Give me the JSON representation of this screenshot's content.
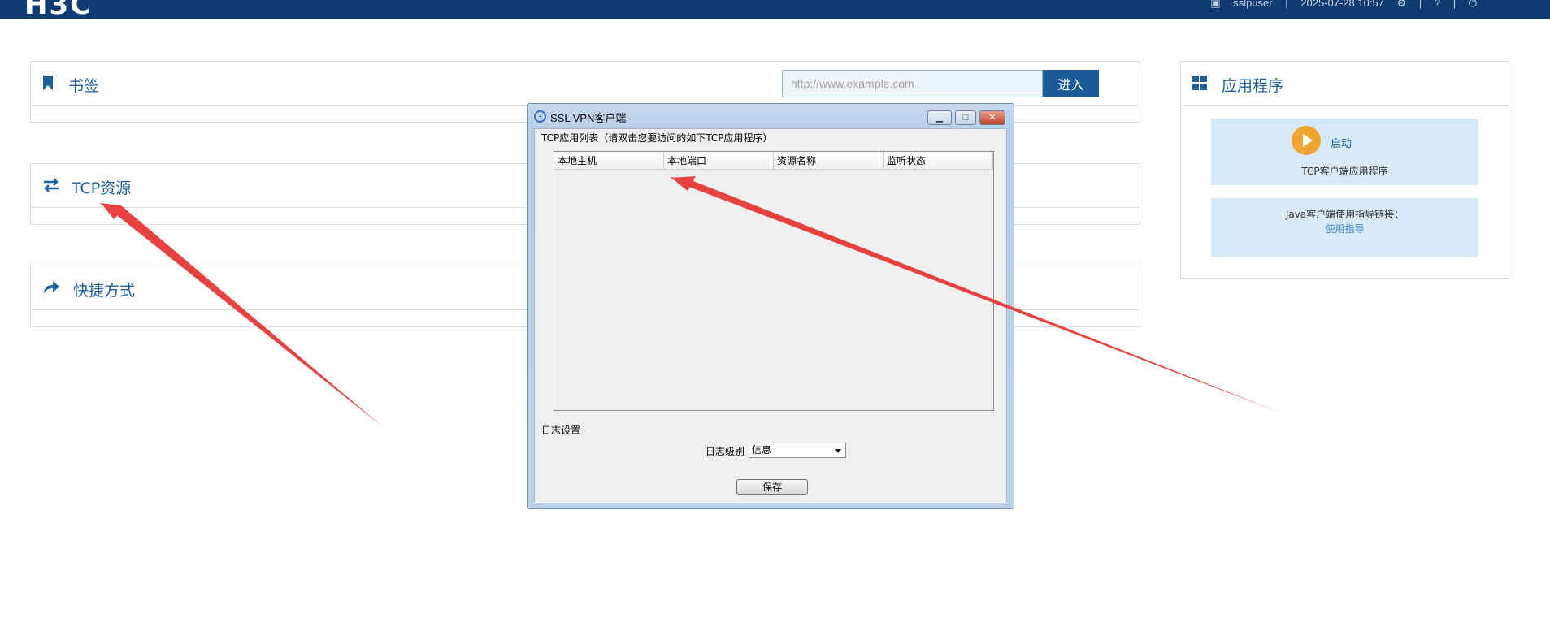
{
  "header": {
    "logo": "H3C",
    "user": "sslpuser",
    "datetime": "2025-07-28 10:57"
  },
  "bookmarks": {
    "title": "书签",
    "url_placeholder": "http://www.example.com",
    "enter_label": "进入"
  },
  "tcp_resources": {
    "title": "TCP资源"
  },
  "shortcuts": {
    "title": "快捷方式"
  },
  "applications": {
    "title": "应用程序",
    "launch_label": "启动",
    "launch_caption": "TCP客户端应用程序",
    "java_guide_text": "Java客户端使用指导链接：",
    "java_guide_link": "使用指导"
  },
  "dialog": {
    "title": "SSL VPN客户端",
    "tcp_group_label": "TCP应用列表（请双击您要访问的如下TCP应用程序）",
    "columns": [
      "本地主机",
      "本地端口",
      "资源名称",
      "监听状态"
    ],
    "log_group_label": "日志设置",
    "log_level_label": "日志级别",
    "log_level_value": "信息",
    "save_label": "保存"
  },
  "colors": {
    "brand": "#0d3b72",
    "accent": "#1f5f9a",
    "card": "#d8e9f7",
    "play": "#efa530",
    "annotation": "#e8413f"
  }
}
